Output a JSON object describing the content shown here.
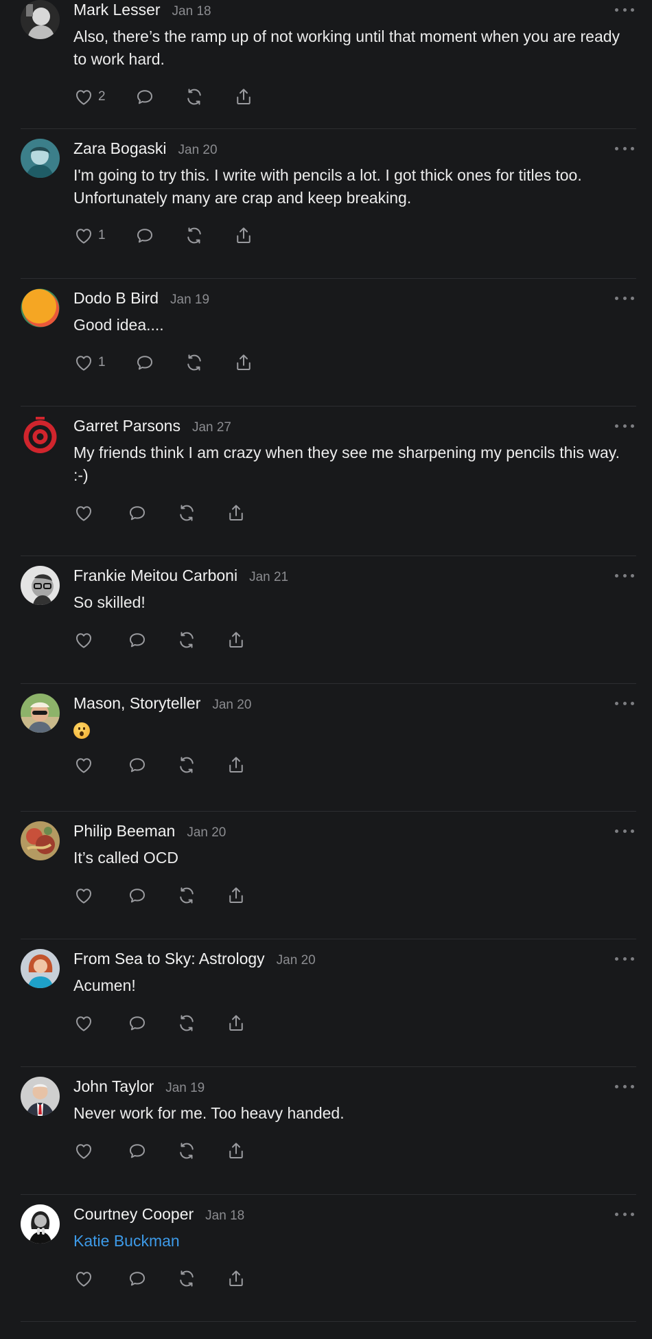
{
  "comments": [
    {
      "name": "Mark Lesser",
      "date": "Jan 18",
      "text": "Also, there’s the ramp up of not working until that moment when you are ready to work hard.",
      "likes": "2",
      "avatar": "bw-portrait"
    },
    {
      "name": "Zara Bogaski",
      "date": "Jan 20",
      "text": "I'm going to try this. I write with pencils a lot. I got thick ones for titles too. Unfortunately many are crap and keep breaking.",
      "likes": "1",
      "avatar": "teal-portrait"
    },
    {
      "name": "Dodo B Bird",
      "date": "Jan 19",
      "text": "Good idea....",
      "likes": "1",
      "avatar": "orange-blob"
    },
    {
      "name": "Garret Parsons",
      "date": "Jan 27",
      "text": "My friends think I am crazy when they see me sharpening my pencils this way. :-)",
      "likes": "",
      "avatar": "red-target"
    },
    {
      "name": "Frankie Meitou Carboni",
      "date": "Jan 21",
      "text": "So skilled!",
      "likes": "",
      "avatar": "bw-glasses"
    },
    {
      "name": "Mason, Storyteller",
      "date": "Jan 20",
      "text": "😮",
      "likes": "",
      "avatar": "sunglasses-portrait"
    },
    {
      "name": "Philip Beeman",
      "date": "Jan 20",
      "text": "It’s called OCD",
      "likes": "",
      "avatar": "painting"
    },
    {
      "name": "From Sea to Sky: Astrology",
      "date": "Jan 20",
      "text": "Acumen!",
      "likes": "",
      "avatar": "redhead-portrait"
    },
    {
      "name": "John Taylor",
      "date": "Jan 19",
      "text": "Never work for me. Too heavy handed.",
      "likes": "",
      "avatar": "suit-portrait"
    },
    {
      "name": "Courtney Cooper",
      "date": "Jan 18",
      "text": "Katie Buckman",
      "likes": "",
      "avatar": "bw-woman",
      "mention": true
    }
  ],
  "icons": {
    "like": "heart-icon",
    "reply": "comment-bubble-icon",
    "restack": "restack-icon",
    "share": "share-icon",
    "more": "more-options-icon"
  },
  "colors": {
    "background": "#18191b",
    "mention": "#3d9ae8",
    "muted": "#8b8c90"
  }
}
